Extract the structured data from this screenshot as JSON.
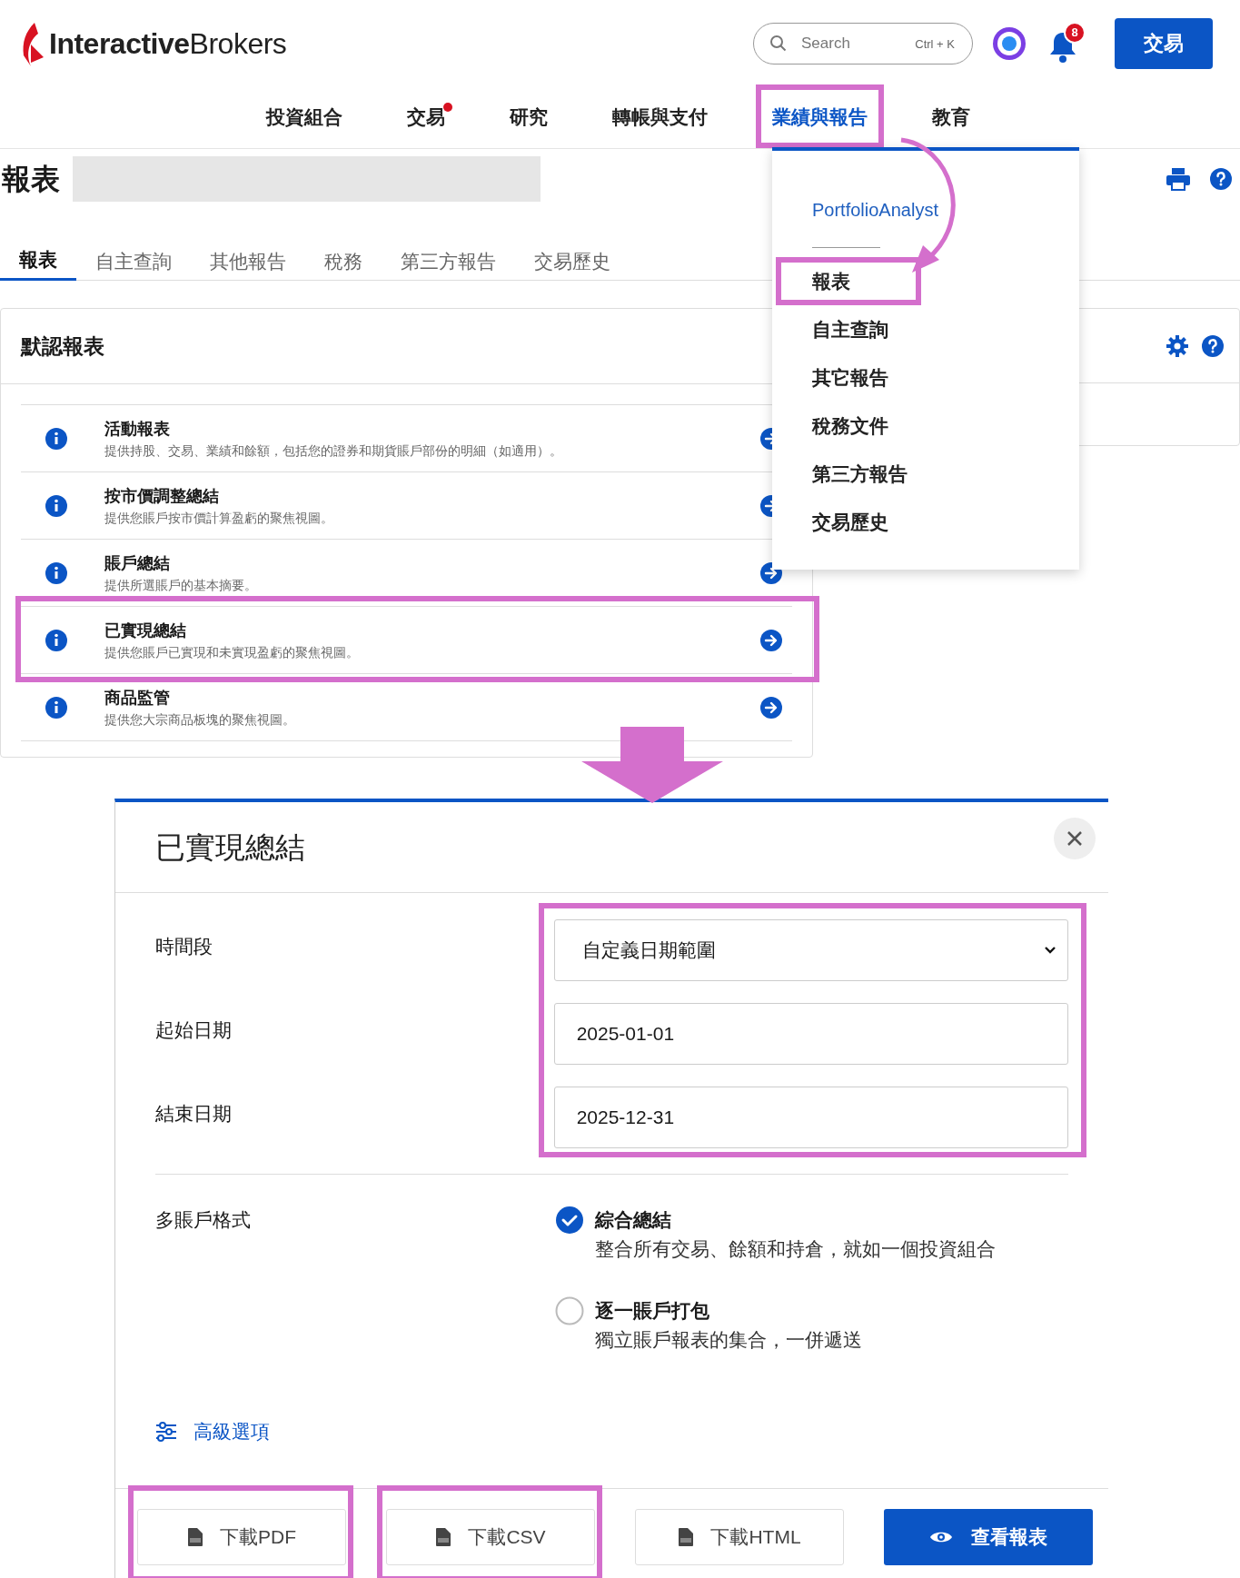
{
  "header": {
    "logo_bold": "Interactive",
    "logo_light": "Brokers",
    "search": {
      "placeholder": "Search",
      "shortcut": "Ctrl + K"
    },
    "notification_count": "8",
    "trade_button": "交易"
  },
  "nav": [
    {
      "label": "投資組合",
      "selected": false,
      "alert": false,
      "highlighted": false
    },
    {
      "label": "交易",
      "selected": false,
      "alert": true,
      "highlighted": false
    },
    {
      "label": "研究",
      "selected": false,
      "alert": false,
      "highlighted": false
    },
    {
      "label": "轉帳與支付",
      "selected": false,
      "alert": false,
      "highlighted": false
    },
    {
      "label": "業績與報告",
      "selected": true,
      "alert": false,
      "highlighted": true
    },
    {
      "label": "教育",
      "selected": false,
      "alert": false,
      "highlighted": false
    }
  ],
  "dropdown": {
    "link": "PortfolioAnalyst",
    "items": [
      {
        "label": "報表",
        "highlighted": true
      },
      {
        "label": "自主查詢",
        "highlighted": false
      },
      {
        "label": "其它報告",
        "highlighted": false
      },
      {
        "label": "稅務文件",
        "highlighted": false
      },
      {
        "label": "第三方報告",
        "highlighted": false
      },
      {
        "label": "交易歷史",
        "highlighted": false
      }
    ]
  },
  "page_title": "報表",
  "tabs": [
    {
      "label": "報表",
      "selected": true
    },
    {
      "label": "自主查詢",
      "selected": false
    },
    {
      "label": "其他報告",
      "selected": false
    },
    {
      "label": "稅務",
      "selected": false
    },
    {
      "label": "第三方報告",
      "selected": false
    },
    {
      "label": "交易歷史",
      "selected": false
    }
  ],
  "card": {
    "title": "默認報表",
    "rows": [
      {
        "title": "活動報表",
        "description": "提供持股、交易、業績和餘額，包括您的證券和期貨賬戶部份的明細（如適用）。",
        "highlighted": false
      },
      {
        "title": "按市價調整總結",
        "description": "提供您賬戶按市價計算盈虧的聚焦視圖。",
        "highlighted": false
      },
      {
        "title": "賬戶總結",
        "description": "提供所選賬戶的基本摘要。",
        "highlighted": false
      },
      {
        "title": "已實現總結",
        "description": "提供您賬戶已實現和未實現盈虧的聚焦視圖。",
        "highlighted": true
      },
      {
        "title": "商品監管",
        "description": "提供您大宗商品板塊的聚焦視圖。",
        "highlighted": false
      }
    ]
  },
  "modal": {
    "title": "已實現總結",
    "fields_highlighted": true,
    "fields": [
      {
        "label": "時間段",
        "kind": "select",
        "value": "自定義日期範圍"
      },
      {
        "label": "起始日期",
        "kind": "input",
        "value": "2025-01-01"
      },
      {
        "label": "結束日期",
        "kind": "input",
        "value": "2025-12-31"
      }
    ],
    "multi_account": {
      "label": "多賬戶格式",
      "options": [
        {
          "title": "綜合總結",
          "description": "整合所有交易、餘額和持倉，就如一個投資組合",
          "selected": true
        },
        {
          "title": "逐一賬戶打包",
          "description": "獨立賬戶報表的集合，一併遞送",
          "selected": false
        }
      ]
    },
    "advanced_link": "高級選項",
    "buttons": [
      {
        "label": "下載PDF",
        "kind": "download",
        "highlighted": true
      },
      {
        "label": "下載CSV",
        "kind": "download",
        "highlighted": true
      },
      {
        "label": "下載HTML",
        "kind": "download",
        "highlighted": false
      },
      {
        "label": "查看報表",
        "kind": "primary",
        "highlighted": false
      }
    ]
  }
}
